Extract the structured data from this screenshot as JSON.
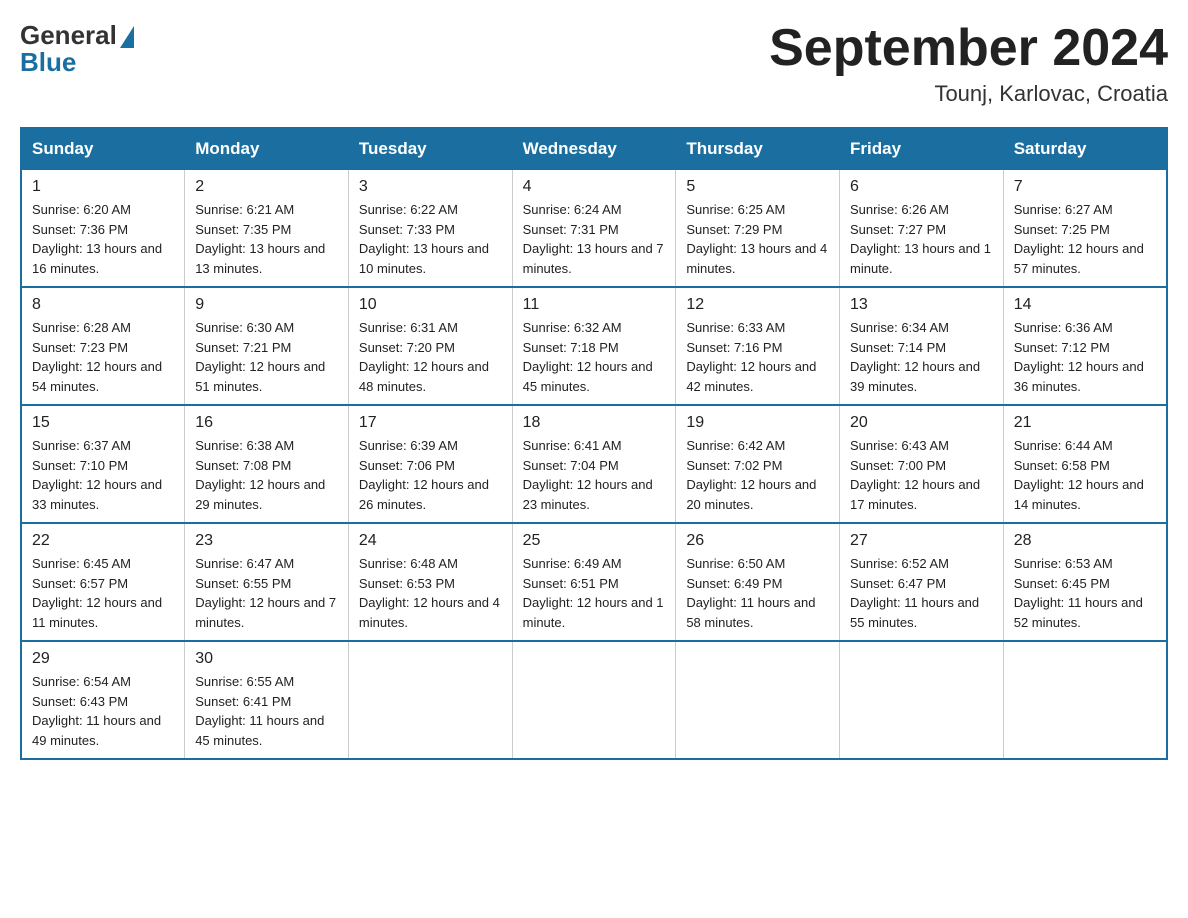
{
  "header": {
    "logo_general": "General",
    "logo_blue": "Blue",
    "month_title": "September 2024",
    "location": "Tounj, Karlovac, Croatia"
  },
  "weekdays": [
    "Sunday",
    "Monday",
    "Tuesday",
    "Wednesday",
    "Thursday",
    "Friday",
    "Saturday"
  ],
  "weeks": [
    [
      {
        "day": "1",
        "sunrise": "6:20 AM",
        "sunset": "7:36 PM",
        "daylight": "13 hours and 16 minutes."
      },
      {
        "day": "2",
        "sunrise": "6:21 AM",
        "sunset": "7:35 PM",
        "daylight": "13 hours and 13 minutes."
      },
      {
        "day": "3",
        "sunrise": "6:22 AM",
        "sunset": "7:33 PM",
        "daylight": "13 hours and 10 minutes."
      },
      {
        "day": "4",
        "sunrise": "6:24 AM",
        "sunset": "7:31 PM",
        "daylight": "13 hours and 7 minutes."
      },
      {
        "day": "5",
        "sunrise": "6:25 AM",
        "sunset": "7:29 PM",
        "daylight": "13 hours and 4 minutes."
      },
      {
        "day": "6",
        "sunrise": "6:26 AM",
        "sunset": "7:27 PM",
        "daylight": "13 hours and 1 minute."
      },
      {
        "day": "7",
        "sunrise": "6:27 AM",
        "sunset": "7:25 PM",
        "daylight": "12 hours and 57 minutes."
      }
    ],
    [
      {
        "day": "8",
        "sunrise": "6:28 AM",
        "sunset": "7:23 PM",
        "daylight": "12 hours and 54 minutes."
      },
      {
        "day": "9",
        "sunrise": "6:30 AM",
        "sunset": "7:21 PM",
        "daylight": "12 hours and 51 minutes."
      },
      {
        "day": "10",
        "sunrise": "6:31 AM",
        "sunset": "7:20 PM",
        "daylight": "12 hours and 48 minutes."
      },
      {
        "day": "11",
        "sunrise": "6:32 AM",
        "sunset": "7:18 PM",
        "daylight": "12 hours and 45 minutes."
      },
      {
        "day": "12",
        "sunrise": "6:33 AM",
        "sunset": "7:16 PM",
        "daylight": "12 hours and 42 minutes."
      },
      {
        "day": "13",
        "sunrise": "6:34 AM",
        "sunset": "7:14 PM",
        "daylight": "12 hours and 39 minutes."
      },
      {
        "day": "14",
        "sunrise": "6:36 AM",
        "sunset": "7:12 PM",
        "daylight": "12 hours and 36 minutes."
      }
    ],
    [
      {
        "day": "15",
        "sunrise": "6:37 AM",
        "sunset": "7:10 PM",
        "daylight": "12 hours and 33 minutes."
      },
      {
        "day": "16",
        "sunrise": "6:38 AM",
        "sunset": "7:08 PM",
        "daylight": "12 hours and 29 minutes."
      },
      {
        "day": "17",
        "sunrise": "6:39 AM",
        "sunset": "7:06 PM",
        "daylight": "12 hours and 26 minutes."
      },
      {
        "day": "18",
        "sunrise": "6:41 AM",
        "sunset": "7:04 PM",
        "daylight": "12 hours and 23 minutes."
      },
      {
        "day": "19",
        "sunrise": "6:42 AM",
        "sunset": "7:02 PM",
        "daylight": "12 hours and 20 minutes."
      },
      {
        "day": "20",
        "sunrise": "6:43 AM",
        "sunset": "7:00 PM",
        "daylight": "12 hours and 17 minutes."
      },
      {
        "day": "21",
        "sunrise": "6:44 AM",
        "sunset": "6:58 PM",
        "daylight": "12 hours and 14 minutes."
      }
    ],
    [
      {
        "day": "22",
        "sunrise": "6:45 AM",
        "sunset": "6:57 PM",
        "daylight": "12 hours and 11 minutes."
      },
      {
        "day": "23",
        "sunrise": "6:47 AM",
        "sunset": "6:55 PM",
        "daylight": "12 hours and 7 minutes."
      },
      {
        "day": "24",
        "sunrise": "6:48 AM",
        "sunset": "6:53 PM",
        "daylight": "12 hours and 4 minutes."
      },
      {
        "day": "25",
        "sunrise": "6:49 AM",
        "sunset": "6:51 PM",
        "daylight": "12 hours and 1 minute."
      },
      {
        "day": "26",
        "sunrise": "6:50 AM",
        "sunset": "6:49 PM",
        "daylight": "11 hours and 58 minutes."
      },
      {
        "day": "27",
        "sunrise": "6:52 AM",
        "sunset": "6:47 PM",
        "daylight": "11 hours and 55 minutes."
      },
      {
        "day": "28",
        "sunrise": "6:53 AM",
        "sunset": "6:45 PM",
        "daylight": "11 hours and 52 minutes."
      }
    ],
    [
      {
        "day": "29",
        "sunrise": "6:54 AM",
        "sunset": "6:43 PM",
        "daylight": "11 hours and 49 minutes."
      },
      {
        "day": "30",
        "sunrise": "6:55 AM",
        "sunset": "6:41 PM",
        "daylight": "11 hours and 45 minutes."
      },
      null,
      null,
      null,
      null,
      null
    ]
  ]
}
